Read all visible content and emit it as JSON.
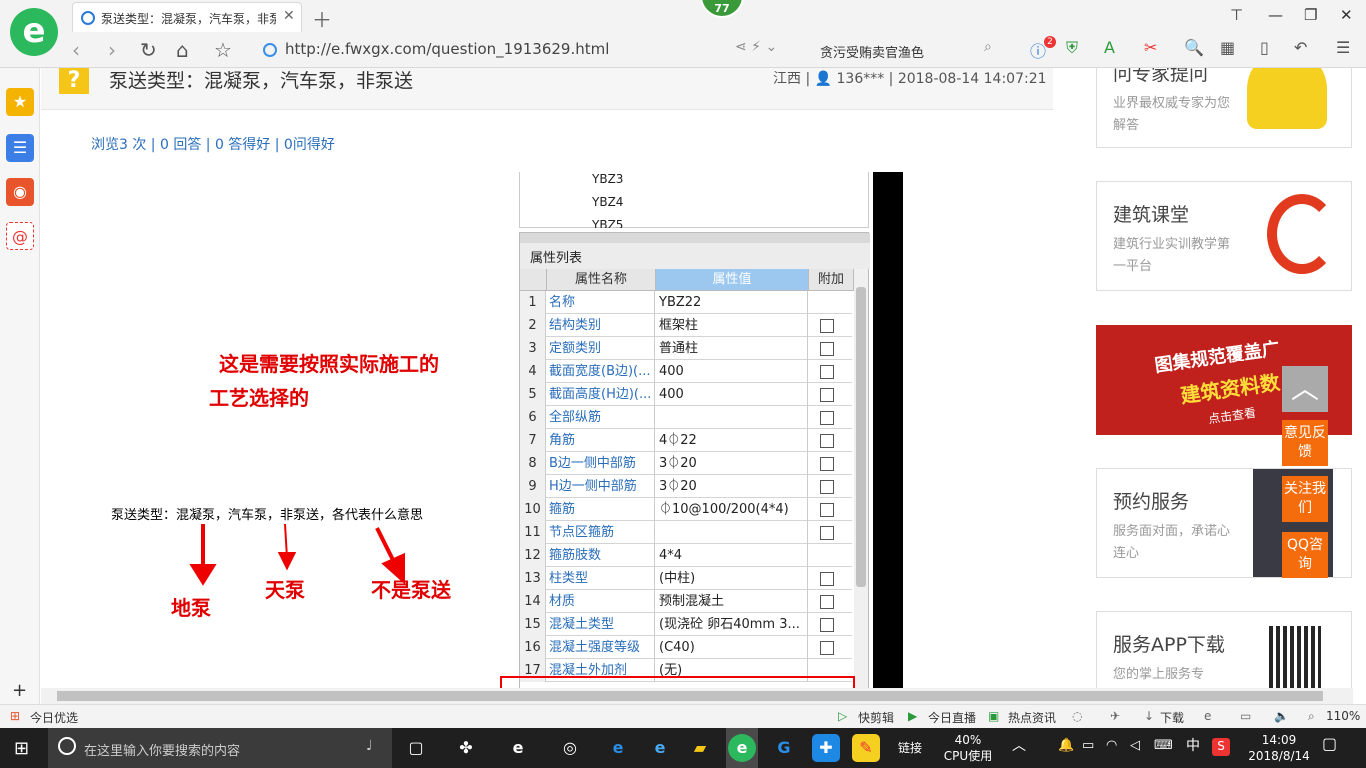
{
  "browser": {
    "tab_title": "泵送类型：混凝泵，汽车泵，非泵",
    "badge": "77",
    "url": "http://e.fwxgx.com/question_1913629.html",
    "search_text": "贪污受贿卖官渔色",
    "toolbar_badge": "2"
  },
  "question": {
    "title": "泵送类型：混凝泵，汽车泵，非泵送",
    "meta": "江西 | 👤 136*** | 2018-08-14 14:07:21",
    "stats": "浏览3 次 | 0 回答 | 0 答得好 | 0问得好"
  },
  "screenshot": {
    "list_items": [
      "YBZ3",
      "YBZ4",
      "YBZ5"
    ],
    "panel_title": "属性列表",
    "col_name": "属性名称",
    "col_value": "属性值",
    "col_extra": "附加",
    "rows": [
      {
        "n": "1",
        "name": "名称",
        "value": "YBZ22",
        "check": false
      },
      {
        "n": "2",
        "name": "结构类别",
        "value": "框架柱",
        "check": true
      },
      {
        "n": "3",
        "name": "定额类别",
        "value": "普通柱",
        "check": true
      },
      {
        "n": "4",
        "name": "截面宽度(B边)(...",
        "value": "400",
        "check": true
      },
      {
        "n": "5",
        "name": "截面高度(H边)(...",
        "value": "400",
        "check": true
      },
      {
        "n": "6",
        "name": "全部纵筋",
        "value": "",
        "check": true
      },
      {
        "n": "7",
        "name": "角筋",
        "value": "4⏀22",
        "check": true
      },
      {
        "n": "8",
        "name": "B边一侧中部筋",
        "value": "3⏀20",
        "check": true
      },
      {
        "n": "9",
        "name": "H边一侧中部筋",
        "value": "3⏀20",
        "check": true
      },
      {
        "n": "10",
        "name": "箍筋",
        "value": "⏀10@100/200(4*4)",
        "check": true
      },
      {
        "n": "11",
        "name": "节点区箍筋",
        "value": "",
        "check": true
      },
      {
        "n": "12",
        "name": "箍筋肢数",
        "value": "4*4",
        "check": false
      },
      {
        "n": "13",
        "name": "柱类型",
        "value": "(中柱)",
        "check": true
      },
      {
        "n": "14",
        "name": "材质",
        "value": "预制混凝土",
        "check": true
      },
      {
        "n": "15",
        "name": "混凝土类型",
        "value": "(现浇砼 卵石40mm 3...",
        "check": true
      },
      {
        "n": "16",
        "name": "混凝土强度等级",
        "value": "(C40)",
        "check": true
      },
      {
        "n": "17",
        "name": "混凝土外加剂",
        "value": "(无)",
        "check": false
      }
    ],
    "note_line1": "这是需要按照实际施工的",
    "note_line2": "工艺选择的",
    "question_text": "泵送类型：混凝泵，汽车泵，非泵送，各代表什么意思",
    "label_ground": "地泵",
    "label_sky": "天泵",
    "label_nonpump": "不是泵送"
  },
  "sidebar": {
    "card1_title": "问专家提问",
    "card1_sub": "业界最权威专家为您解答",
    "card2_title": "建筑课堂",
    "card2_sub": "建筑行业实训教学第一平台",
    "banner_line1": "图集规范覆盖广",
    "banner_line2": "建筑资料数",
    "banner_cta": "点击查看",
    "card3_title": "预约服务",
    "card3_sub": "服务面对面，承诺心连心",
    "card4_title": "服务APP下载",
    "card4_sub": "您的掌上服务专",
    "feedback": "意见反馈",
    "follow": "关注我们",
    "qq": "QQ咨询"
  },
  "statusbar": {
    "left": "今日优选",
    "items": [
      "快剪辑",
      "今日直播",
      "热点资讯"
    ],
    "download": "下载",
    "zoom": "110%"
  },
  "taskbar": {
    "search_placeholder": "在这里输入你要搜索的内容",
    "link_label": "链接",
    "cpu_pct": "40%",
    "cpu_label": "CPU使用",
    "ime": "中",
    "time": "14:09",
    "date": "2018/8/14"
  }
}
